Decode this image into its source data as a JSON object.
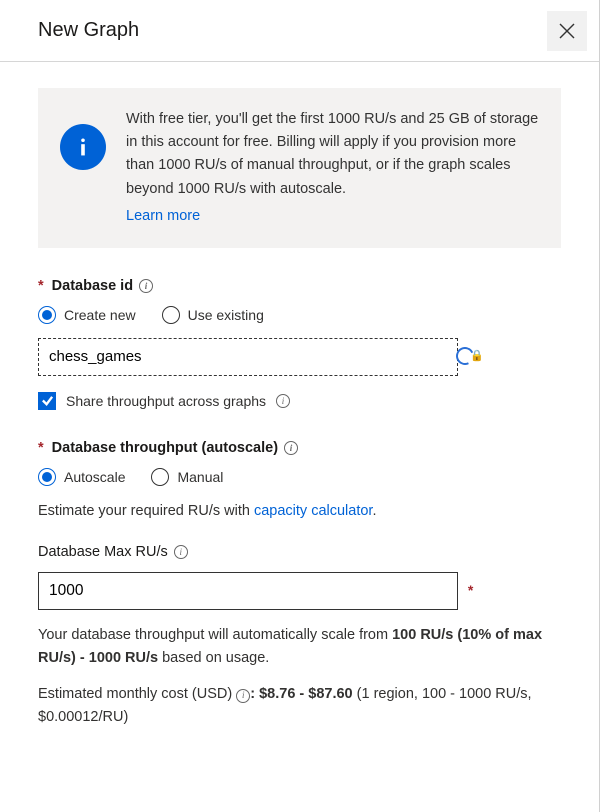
{
  "header": {
    "title": "New Graph"
  },
  "info": {
    "text": "With free tier, you'll get the first 1000 RU/s and 25 GB of storage in this account for free. Billing will apply if you provision more than 1000 RU/s of manual throughput, or if the graph scales beyond 1000 RU/s with autoscale.",
    "learn_more": "Learn more"
  },
  "database_id": {
    "label": "Database id",
    "options": {
      "create_new": "Create new",
      "use_existing": "Use existing",
      "selected": "create_new"
    },
    "value": "chess_games"
  },
  "share_throughput": {
    "label": "Share throughput across graphs",
    "checked": true
  },
  "database_throughput": {
    "label": "Database throughput (autoscale)",
    "options": {
      "autoscale": "Autoscale",
      "manual": "Manual",
      "selected": "autoscale"
    }
  },
  "estimate_ru": {
    "prefix": "Estimate your required RU/s with ",
    "link": "capacity calculator",
    "suffix": "."
  },
  "max_ru": {
    "label": "Database Max RU/s",
    "value": "1000"
  },
  "scale_note": {
    "prefix": "Your database throughput will automatically scale from ",
    "bold": "100 RU/s (10% of max RU/s) - 1000 RU/s",
    "suffix": " based on usage."
  },
  "cost": {
    "prefix": "Estimated monthly cost (USD) ",
    "bold": ": $8.76 - $87.60 ",
    "suffix": "(1 region, 100 - 1000 RU/s, $0.00012/RU)"
  }
}
